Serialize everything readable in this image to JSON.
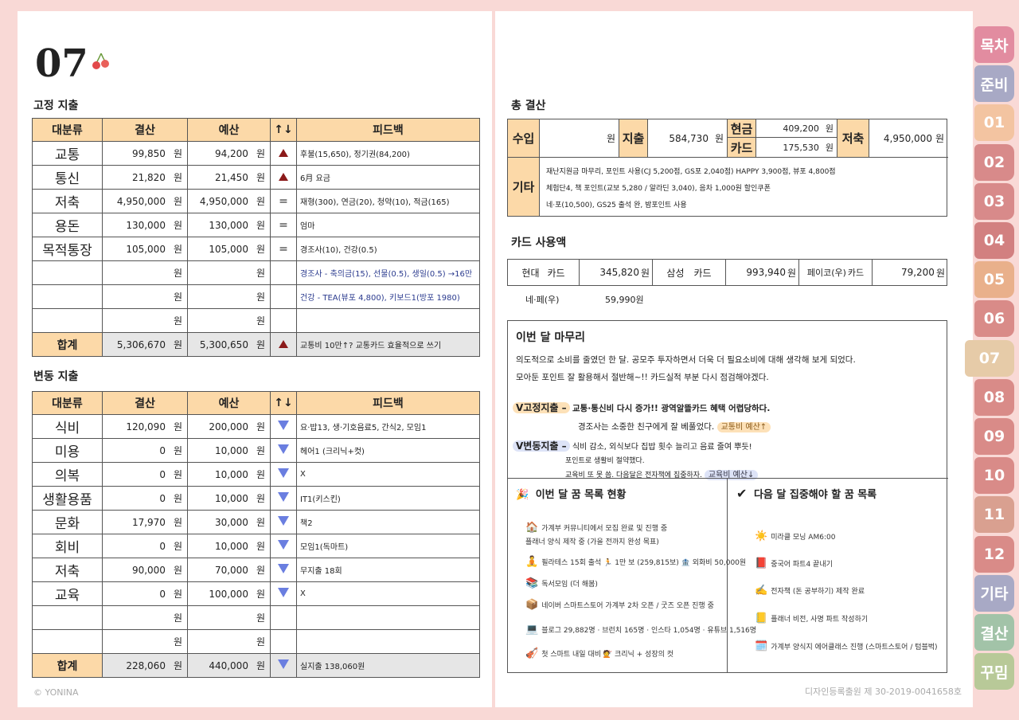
{
  "page_number": "07",
  "fixed": {
    "title": "고정 지출",
    "headers": [
      "대분류",
      "결산",
      "예산",
      "↑↓",
      "피드백"
    ],
    "rows": [
      {
        "cat": "교통",
        "actual": "99,850",
        "budget": "94,200",
        "mark": "up",
        "feedback": "후불(15,650), 정기권(84,200)",
        "blue": false
      },
      {
        "cat": "통신",
        "actual": "21,820",
        "budget": "21,450",
        "mark": "up",
        "feedback": "6月 요금",
        "blue": false
      },
      {
        "cat": "저축",
        "actual": "4,950,000",
        "budget": "4,950,000",
        "mark": "=",
        "feedback": "재형(300), 연금(20), 청약(10), 적금(165)",
        "blue": false
      },
      {
        "cat": "용돈",
        "actual": "130,000",
        "budget": "130,000",
        "mark": "=",
        "feedback": "엄마",
        "blue": false
      },
      {
        "cat": "목적통장",
        "actual": "105,000",
        "budget": "105,000",
        "mark": "=",
        "feedback": "경조사(10), 건강(0.5)",
        "blue": false
      },
      {
        "cat": "",
        "actual": "",
        "budget": "",
        "mark": "",
        "feedback": "경조사 - 축의금(15), 선물(0.5), 생일(0.5) →16만",
        "blue": true
      },
      {
        "cat": "",
        "actual": "",
        "budget": "",
        "mark": "",
        "feedback": "건강 - TEA(뷰포 4,800), 키보드1(방포 1980)",
        "blue": true
      },
      {
        "cat": "",
        "actual": "",
        "budget": "",
        "mark": "",
        "feedback": "",
        "blue": false
      }
    ],
    "total": {
      "cat": "합계",
      "actual": "5,306,670",
      "budget": "5,300,650",
      "mark": "up",
      "feedback": "교통비 10만↑? 교통카드 효율적으로 쓰기"
    }
  },
  "variable": {
    "title": "변동 지출",
    "headers": [
      "대분류",
      "결산",
      "예산",
      "↑↓",
      "피드백"
    ],
    "rows": [
      {
        "cat": "식비",
        "actual": "120,090",
        "budget": "200,000",
        "mark": "down",
        "feedback": "요·밥13, 생·기호음료5, 간식2, 모임1"
      },
      {
        "cat": "미용",
        "actual": "0",
        "budget": "10,000",
        "mark": "down",
        "feedback": "헤어1 (크리닉+컷)"
      },
      {
        "cat": "의복",
        "actual": "0",
        "budget": "10,000",
        "mark": "down",
        "feedback": "X"
      },
      {
        "cat": "생활용품",
        "actual": "0",
        "budget": "10,000",
        "mark": "down",
        "feedback": "IT1(키스킨)"
      },
      {
        "cat": "문화",
        "actual": "17,970",
        "budget": "30,000",
        "mark": "down",
        "feedback": "책2"
      },
      {
        "cat": "회비",
        "actual": "0",
        "budget": "10,000",
        "mark": "down",
        "feedback": "모임1(독마트)"
      },
      {
        "cat": "저축",
        "actual": "90,000",
        "budget": "70,000",
        "mark": "down",
        "feedback": "무지출 18회"
      },
      {
        "cat": "교육",
        "actual": "0",
        "budget": "100,000",
        "mark": "down",
        "feedback": "X"
      },
      {
        "cat": "",
        "actual": "",
        "budget": "",
        "mark": "",
        "feedback": ""
      },
      {
        "cat": "",
        "actual": "",
        "budget": "",
        "mark": "",
        "feedback": ""
      }
    ],
    "total": {
      "cat": "합계",
      "actual": "228,060",
      "budget": "440,000",
      "mark": "down",
      "feedback": "실지출 138,060원"
    }
  },
  "won": "원",
  "total_summary": {
    "title": "총 결산",
    "income_label": "수입",
    "income_value": "",
    "expense_label": "지출",
    "expense_value": "584,730",
    "cash_label": "현금",
    "cash_value": "409,200",
    "card_label": "카드",
    "card_value": "175,530",
    "savings_label": "저축",
    "savings_value": "4,950,000",
    "other_label": "기타",
    "other_lines": [
      "재난지원금 마무리, 포인트 사용(CJ 5,200점, GS포 2,040점) HAPPY 3,900점, 뷰포 4,800점",
      "체험단4, 책 포인트(교보 5,280 / 알라딘 3,040), 음차 1,000원 할인쿠폰",
      "네·포(10,500), GS25 출석 완, 밤포인트 사용"
    ]
  },
  "card_usage": {
    "title": "카드 사용액",
    "cards": [
      {
        "name": "현대",
        "suffix": "카드",
        "value": "345,820"
      },
      {
        "name": "삼성",
        "suffix": "카드",
        "value": "993,940"
      },
      {
        "name": "페이코(우)",
        "suffix": "카드",
        "value": "79,200"
      }
    ],
    "extra_name": "네·페(우)",
    "extra_value": "59,990원"
  },
  "wrapup": {
    "title": "이번 달 마무리",
    "lines": [
      "의도적으로 소비를 줄였던 한 달. 공모주 투자하면서 더욱 더 필요소비에 대해 생각해 보게 되었다.",
      "모아둔 포인트 잘 활용해서 절반해~!! 카드실적 부분 다시 점검해야겠다."
    ],
    "fixed_head": "V고정지출 –",
    "fixed_line1": "교통·통신비 다시 증가!! 광역알뜰카드 혜택 어렵당하다.",
    "fixed_line2": "경조사는 소중한 친구에게 잘 베풀었다.",
    "fixed_tag": "교통비 예산↑",
    "var_head": "V변동지출 –",
    "var_line1": "식비 감소, 외식보다 집밥 횟수 늘리고 음료 줄여 뿌듯!",
    "var_line2": "포인트로 생활비 절약했다.",
    "var_line3": "교육비 또 못 씀. 다음달은 전자책에 집중하자.",
    "var_tag": "교육비 예산↓"
  },
  "dreams_now": {
    "title": "이번 달 꿈 목록 현황",
    "items": [
      {
        "icon": "🏠",
        "text": "가계부 커뮤니티에서 모집 완료 및 진행 중"
      },
      {
        "icon": "",
        "text": "플래너 양식 제작 중 (가을 전까지 완성 목표)"
      },
      {
        "icon": "🧘",
        "text": "필라테스 15회 출석  🏃 1만 보 (259,815보)  🏦 외화비 50,000원"
      },
      {
        "icon": "📚",
        "text": "독서모임 (더 해봄)"
      },
      {
        "icon": "📦",
        "text": "네이버 스마트스토어 가계부 2차 오픈 / 굿즈 오픈 진행 중"
      },
      {
        "icon": "💻",
        "text": "블로그 29,882명 · 브런치 165명 · 인스타 1,054명 · 유튜브 1,516명"
      },
      {
        "icon": "🎻",
        "text": "첫 스마트 내일 대비 💇 크리닉 + 성장의 컷"
      }
    ]
  },
  "dreams_next": {
    "title": "다음 달 집중해야 할 꿈 목록",
    "items": [
      {
        "icon": "☀️",
        "text": "미라클 모닝 AM6:00"
      },
      {
        "icon": "📕",
        "text": "중국어 파트4 끝내기"
      },
      {
        "icon": "✍️",
        "text": "전자책 (돈 공부하기) 제작 완료"
      },
      {
        "icon": "📒",
        "text": "플래너 비전, 사명 파트 작성하기"
      },
      {
        "icon": "🗓️",
        "text": "가계부 양식지 에어클래스 진행 (스마트스토어 / 텀블벅)"
      }
    ]
  },
  "tabs": [
    {
      "label": "목차",
      "color": "#e28ca0"
    },
    {
      "label": "준비",
      "color": "#a8a9c5"
    },
    {
      "label": "01",
      "color": "#f3c4a1"
    },
    {
      "label": "02",
      "color": "#d88a8a"
    },
    {
      "label": "03",
      "color": "#d88a8a"
    },
    {
      "label": "04",
      "color": "#d28080"
    },
    {
      "label": "05",
      "color": "#e9b08b"
    },
    {
      "label": "06",
      "color": "#d98b88"
    },
    {
      "label": "07",
      "color": "#e6cba8"
    },
    {
      "label": "08",
      "color": "#d98b88"
    },
    {
      "label": "09",
      "color": "#d98b88"
    },
    {
      "label": "10",
      "color": "#d98b88"
    },
    {
      "label": "11",
      "color": "#d9a090"
    },
    {
      "label": "12",
      "color": "#d98b88"
    },
    {
      "label": "기타",
      "color": "#a8a9c5"
    },
    {
      "label": "결산",
      "color": "#a2c3a8"
    },
    {
      "label": "꾸밈",
      "color": "#b8c998"
    }
  ],
  "active_tab": "07",
  "footer_left": "© YONINA",
  "footer_right": "디자인등록출원 제 30-2019-0041658호"
}
